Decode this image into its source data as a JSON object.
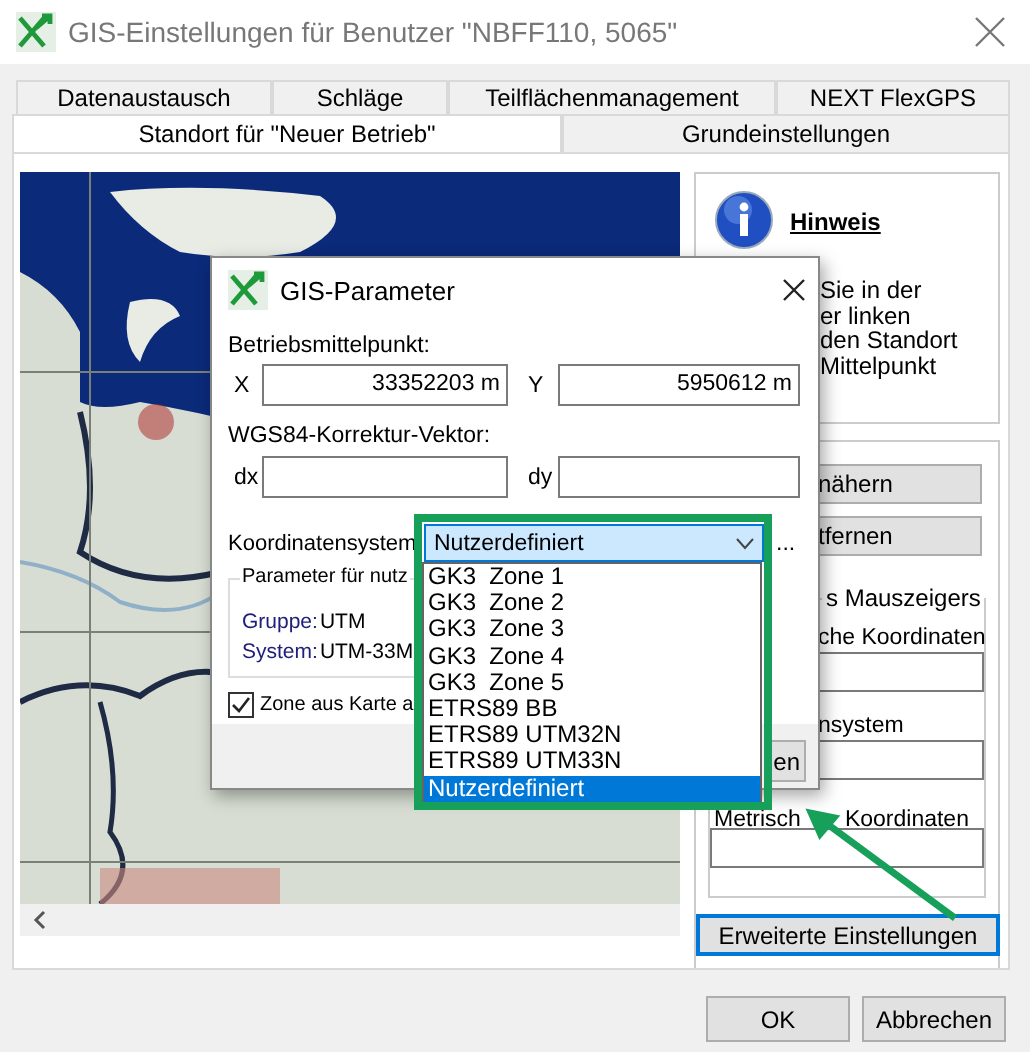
{
  "window": {
    "title": "GIS-Einstellungen für Benutzer \"NBFF110, 5065\""
  },
  "tab_rows": [
    [
      {
        "label": "Datenaustausch",
        "selected": false
      },
      {
        "label": "Schläge",
        "selected": false
      },
      {
        "label": "Teilflächenmanagement",
        "selected": false
      },
      {
        "label": "NEXT FlexGPS",
        "selected": false
      }
    ],
    [
      {
        "label": "Standort für \"Neuer Betrieb\"",
        "selected": true
      },
      {
        "label": "Grundeinstellungen",
        "selected": false
      }
    ]
  ],
  "map": {
    "kind": "picture"
  },
  "hint": {
    "title": "Hinweis",
    "lines": [
      "Sie in der",
      "er linken",
      "den Standort",
      "Mittelpunkt"
    ]
  },
  "zoom_buttons": [
    "nähern",
    "tfernen"
  ],
  "mouse_group": {
    "legend": "s Mauszeigers",
    "fields": [
      {
        "labels": [
          "che Koordinaten"
        ]
      },
      {
        "labels": [
          "nsystem"
        ]
      },
      {
        "labels": [
          "Metrisch",
          "Koordinaten"
        ]
      }
    ]
  },
  "advanced_button": "Erweiterte Einstellungen",
  "footer_buttons": [
    "OK",
    "Abbrechen"
  ],
  "dialog": {
    "title": "GIS-Parameter",
    "center_label": "Betriebsmittelpunkt:",
    "center_fields": [
      {
        "label": "X",
        "value": "33352203 m"
      },
      {
        "label": "Y",
        "value": "5950612 m"
      }
    ],
    "correction_label": "WGS84-Korrektur-Vektor:",
    "correction_fields": [
      {
        "label": "dx"
      },
      {
        "label": "dy"
      }
    ],
    "coordinate_system": {
      "label": "Koordinatensystem",
      "value": "Nutzerdefiniert",
      "more": "...",
      "expanded": true,
      "options": [
        {
          "label": "GK3  Zone 1",
          "selected": false
        },
        {
          "label": "GK3  Zone 2",
          "selected": false
        },
        {
          "label": "GK3  Zone 3",
          "selected": false
        },
        {
          "label": "GK3  Zone 4",
          "selected": false
        },
        {
          "label": "GK3  Zone 5",
          "selected": false
        },
        {
          "label": "ETRS89 BB",
          "selected": false
        },
        {
          "label": "ETRS89 UTM32N",
          "selected": false
        },
        {
          "label": "ETRS89 UTM33N",
          "selected": false
        },
        {
          "label": "Nutzerdefiniert",
          "selected": true
        }
      ]
    },
    "parameters": {
      "legend": "Parameter für nutz",
      "rows": [
        {
          "label": "Gruppe:",
          "value": "UTM"
        },
        {
          "label": "System:",
          "value": "UTM-33M"
        }
      ]
    },
    "zone_checkbox": {
      "label": "Zone aus Karte a",
      "checked": true
    },
    "footer_button": "en"
  }
}
